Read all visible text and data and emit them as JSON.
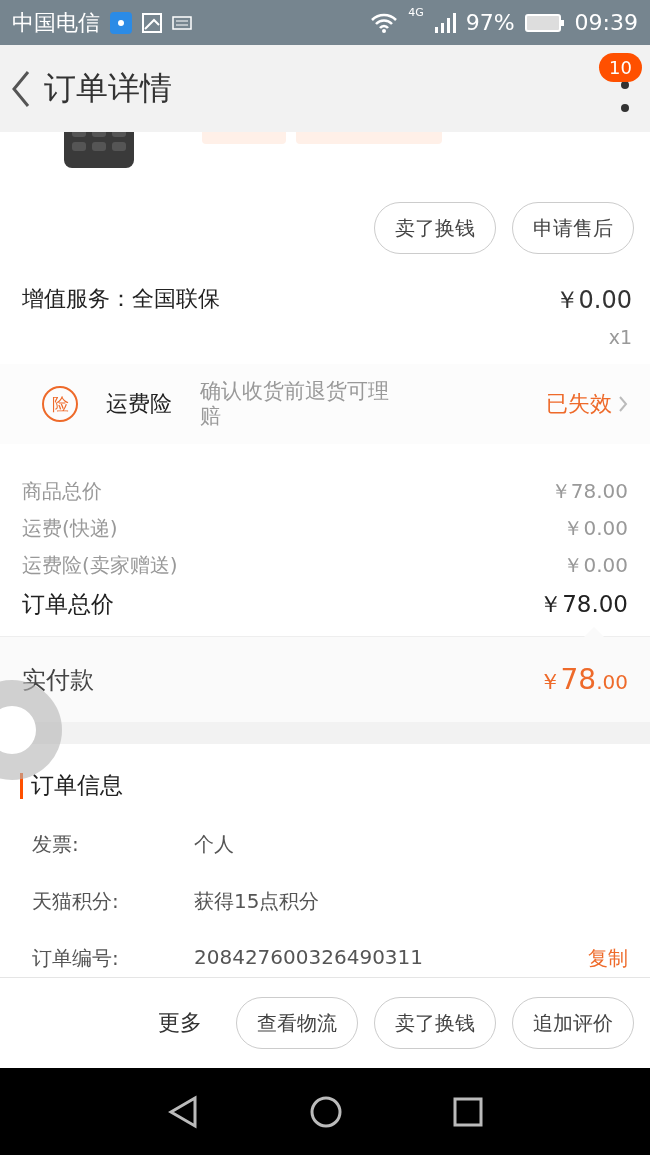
{
  "status_bar": {
    "carrier": "中国电信",
    "network": "4G",
    "battery": "97%",
    "time": "09:39"
  },
  "header": {
    "title": "订单详情",
    "badge": "10"
  },
  "product": {
    "buttons": [
      "卖了换钱",
      "申请售后"
    ]
  },
  "service": {
    "label": "增值服务：全国联保",
    "price": "￥0.00",
    "quantity": "x1"
  },
  "insurance": {
    "icon_text": "险",
    "name": "运费险",
    "description": "确认收货前退货可理赔",
    "status": "已失效"
  },
  "price_lines": [
    {
      "label": "商品总价",
      "value": "￥78.00",
      "kind": "minor"
    },
    {
      "label": "运费(快递)",
      "value": "￥0.00",
      "kind": "minor"
    },
    {
      "label": "运费险(卖家赠送)",
      "value": "￥0.00",
      "kind": "minor"
    },
    {
      "label": "订单总价",
      "value": "￥78.00",
      "kind": "total"
    }
  ],
  "paid": {
    "label": "实付款",
    "currency": "￥",
    "amount": "78",
    "cents": ".00"
  },
  "order_info": {
    "title": "订单信息",
    "rows": [
      {
        "label": "发票:",
        "value": "个人"
      },
      {
        "label": "天猫积分:",
        "value": "获得15点积分"
      },
      {
        "label": "订单编号:",
        "value": "208427600326490311",
        "action": "复制"
      }
    ]
  },
  "bottom_bar": {
    "more": "更多",
    "buttons": [
      "查看物流",
      "卖了换钱",
      "追加评价"
    ]
  }
}
